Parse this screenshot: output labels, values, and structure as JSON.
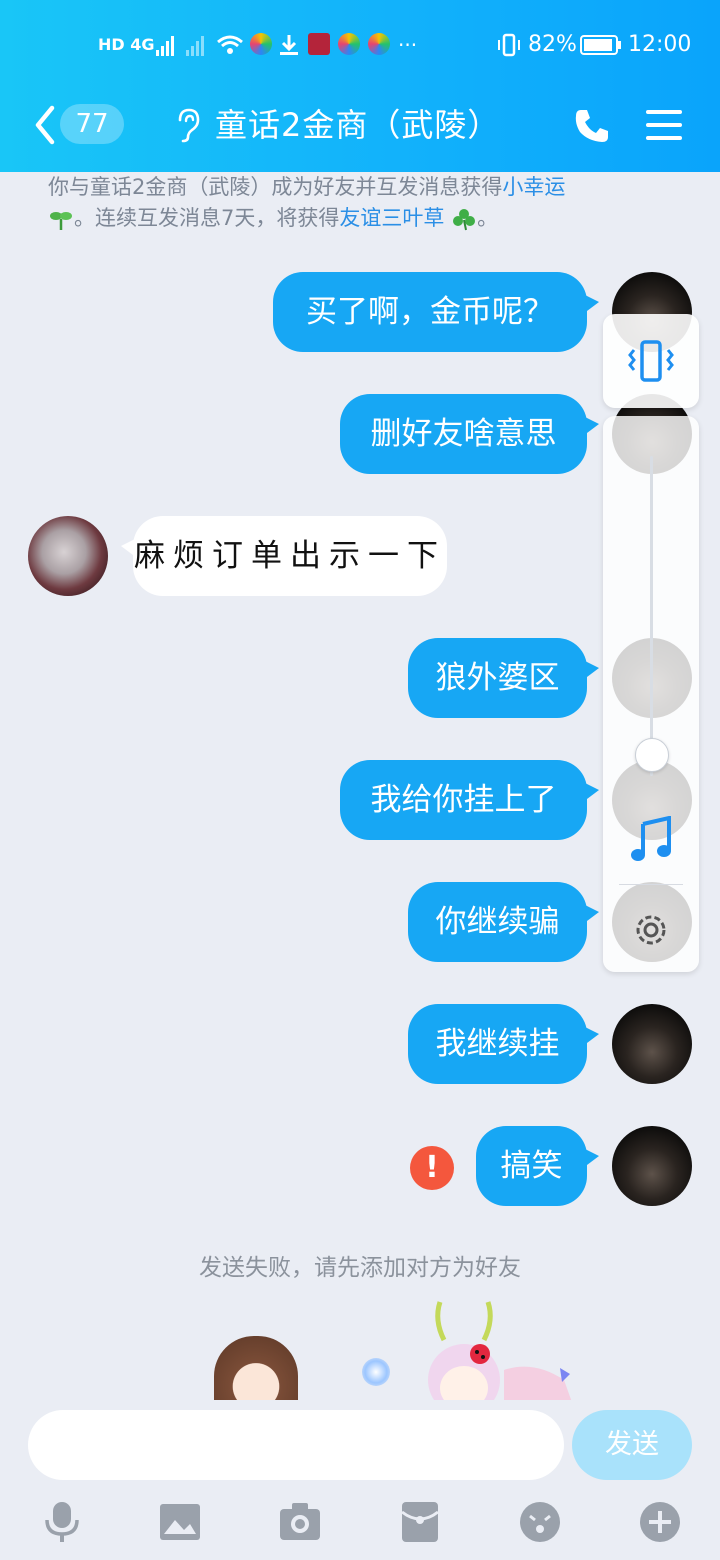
{
  "status_bar": {
    "left_indicators": "HD 4G",
    "more": "···",
    "battery": "82%",
    "time": "12:00"
  },
  "header": {
    "unread_count": "77",
    "title": "童话2金商（武陵）"
  },
  "notice": {
    "part1": "你与童话2金商（武陵）成为好友并互发消息获得",
    "link1": "小幸运",
    "part2": "。连续互发消息7天，将获得",
    "link2": "友谊三叶草",
    "part3": "。"
  },
  "messages": [
    {
      "from": "me",
      "text": "买了啊，金币呢？"
    },
    {
      "from": "me",
      "text": "删好友啥意思"
    },
    {
      "from": "other",
      "text": "麻烦订单出示一下"
    },
    {
      "from": "me",
      "text": "狼外婆区"
    },
    {
      "from": "me",
      "text": "我给你挂上了"
    },
    {
      "from": "me",
      "text": "你继续骗"
    },
    {
      "from": "me",
      "text": "我继续挂"
    },
    {
      "from": "me",
      "text": "搞笑",
      "failed": true
    }
  ],
  "error_mark": "!",
  "system_note": "发送失败，请先添加对方为好友",
  "side_panel": {
    "icons": [
      "vibrate-icon",
      "music-note-icon",
      "settings-gear-icon"
    ],
    "volume_level": 0.1
  },
  "composer": {
    "input_value": "",
    "send_label": "发送"
  },
  "toolbar_icons": [
    "microphone-icon",
    "image-icon",
    "camera-icon",
    "red-packet-icon",
    "emoji-icon",
    "plus-icon"
  ],
  "colors": {
    "header": "#12b2fb",
    "bubble_me": "#17a7f4",
    "link": "#2b8fe6",
    "error": "#f4573d",
    "send_disabled": "#a9e2fb"
  }
}
